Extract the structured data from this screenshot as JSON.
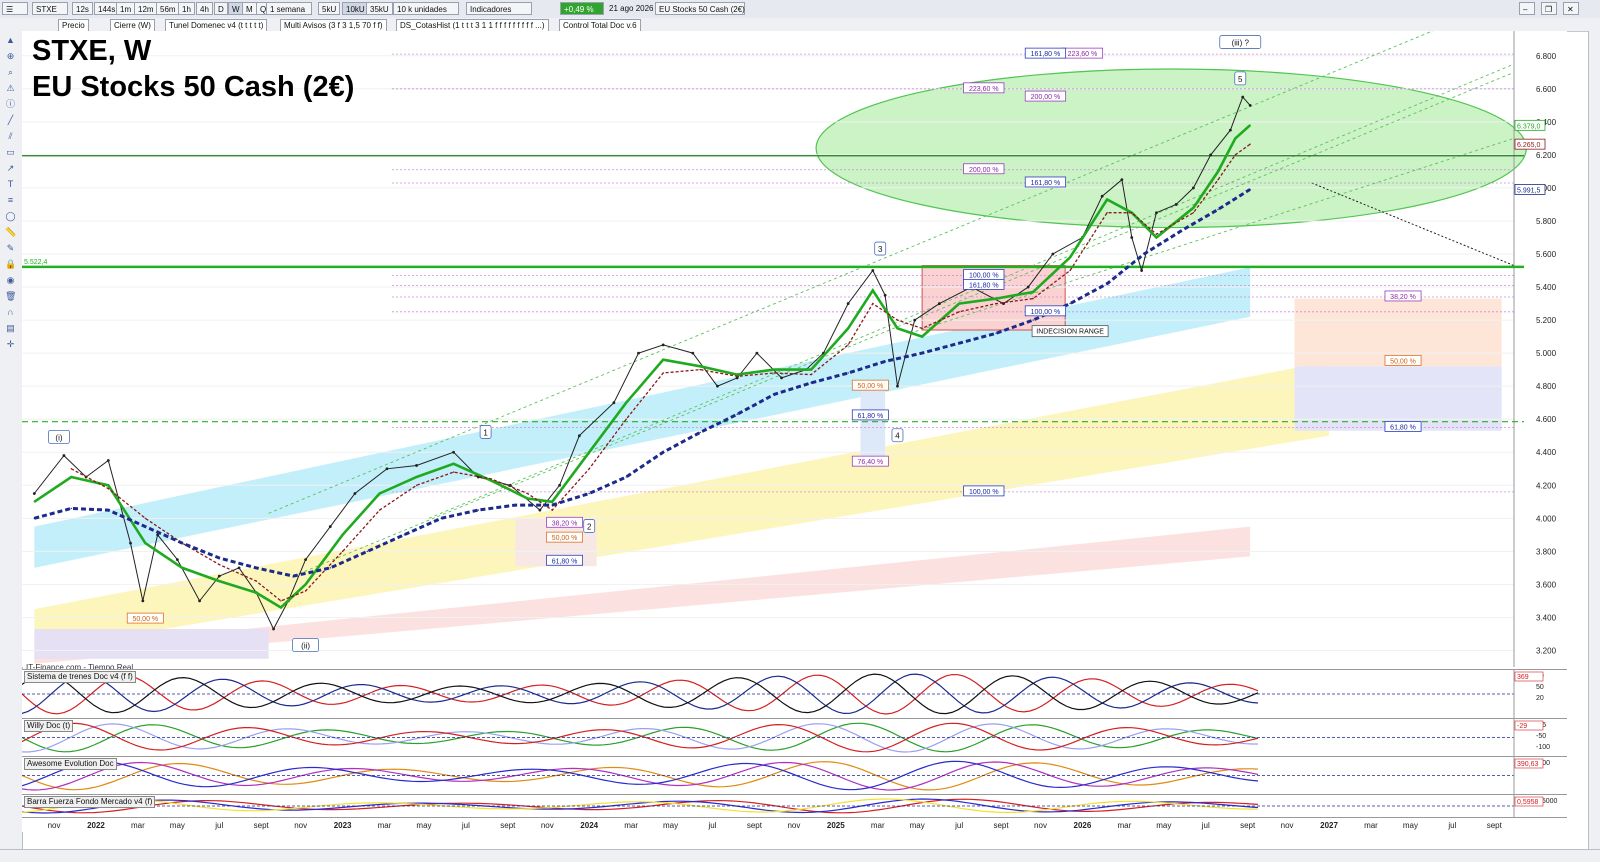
{
  "toolbar": {
    "symbol": "STXE",
    "buttons": [
      "12s",
      "144s",
      "1m",
      "12m",
      "56m",
      "1h",
      "4h",
      "D",
      "W",
      "M",
      "Q"
    ],
    "active_button": "W",
    "period": "1 semana",
    "unit_buttons": [
      "5kU",
      "10kU",
      "35kU"
    ],
    "active_unit": "10kU",
    "units_select": "10 k unidades",
    "indicators_label": "Indicadores",
    "change": "+0,49 %",
    "date": "21 ago 2026",
    "instrument": "EU Stocks 50 Cash (2€)"
  },
  "indicator_bar": [
    "Precio",
    "Cierre (W)",
    "Tunel Domenec v4 (t t t t t)",
    "Multi Avisos (3 f 3 1,5 70 f f)",
    "DS_CotasHist (1 t t t 3 1 1 f f f f f f f f f ...)",
    "Control Total Doc v.6"
  ],
  "chart_title": {
    "line1": "STXE, W",
    "line2": "EU Stocks 50 Cash (2€)"
  },
  "source_text": "IT-Finance.com - Tiempo Real",
  "chart_data": {
    "type": "line",
    "xlabel": "",
    "ylabel": "",
    "ylim": [
      3100,
      6950
    ],
    "xlim": [
      2021.7,
      2027.75
    ],
    "y_ticks": [
      3200,
      3400,
      3600,
      3800,
      4000,
      4200,
      4400,
      4600,
      4800,
      5000,
      5200,
      5400,
      5600,
      5800,
      6000,
      6200,
      6400,
      6600,
      6800
    ],
    "y_tick_labels": [
      "3.200",
      "3.400",
      "3.600",
      "3.800",
      "4.000",
      "4.200",
      "4.400",
      "4.600",
      "4.800",
      "5.000",
      "5.200",
      "5.400",
      "5.600",
      "5.800",
      "6.000",
      "6.200",
      "6.400",
      "6.600",
      "6.800"
    ],
    "x_labels": [
      {
        "x": 2021.83,
        "label": "nov"
      },
      {
        "x": 2022.0,
        "label": "2022"
      },
      {
        "x": 2022.17,
        "label": "mar"
      },
      {
        "x": 2022.33,
        "label": "may"
      },
      {
        "x": 2022.5,
        "label": "jul"
      },
      {
        "x": 2022.67,
        "label": "sept"
      },
      {
        "x": 2022.83,
        "label": "nov"
      },
      {
        "x": 2023.0,
        "label": "2023"
      },
      {
        "x": 2023.17,
        "label": "mar"
      },
      {
        "x": 2023.33,
        "label": "may"
      },
      {
        "x": 2023.5,
        "label": "jul"
      },
      {
        "x": 2023.67,
        "label": "sept"
      },
      {
        "x": 2023.83,
        "label": "nov"
      },
      {
        "x": 2024.0,
        "label": "2024"
      },
      {
        "x": 2024.17,
        "label": "mar"
      },
      {
        "x": 2024.33,
        "label": "may"
      },
      {
        "x": 2024.5,
        "label": "jul"
      },
      {
        "x": 2024.67,
        "label": "sept"
      },
      {
        "x": 2024.83,
        "label": "nov"
      },
      {
        "x": 2025.0,
        "label": "2025"
      },
      {
        "x": 2025.17,
        "label": "mar"
      },
      {
        "x": 2025.33,
        "label": "may"
      },
      {
        "x": 2025.5,
        "label": "jul"
      },
      {
        "x": 2025.67,
        "label": "sept"
      },
      {
        "x": 2025.83,
        "label": "nov"
      },
      {
        "x": 2026.0,
        "label": "2026"
      },
      {
        "x": 2026.17,
        "label": "mar"
      },
      {
        "x": 2026.33,
        "label": "may"
      },
      {
        "x": 2026.5,
        "label": "jul"
      },
      {
        "x": 2026.67,
        "label": "sept"
      },
      {
        "x": 2026.83,
        "label": "nov"
      },
      {
        "x": 2027.0,
        "label": "2027"
      },
      {
        "x": 2027.17,
        "label": "mar"
      },
      {
        "x": 2027.33,
        "label": "may"
      },
      {
        "x": 2027.5,
        "label": "jul"
      },
      {
        "x": 2027.67,
        "label": "sept"
      }
    ],
    "series": [
      {
        "color": "#222222",
        "points": [
          [
            2021.75,
            4150
          ],
          [
            2021.87,
            4380
          ],
          [
            2021.96,
            4250
          ],
          [
            2022.05,
            4350
          ],
          [
            2022.14,
            3850
          ],
          [
            2022.19,
            3500
          ],
          [
            2022.25,
            3900
          ],
          [
            2022.33,
            3750
          ],
          [
            2022.42,
            3500
          ],
          [
            2022.5,
            3650
          ],
          [
            2022.58,
            3700
          ],
          [
            2022.65,
            3550
          ],
          [
            2022.72,
            3330
          ],
          [
            2022.78,
            3500
          ],
          [
            2022.85,
            3750
          ],
          [
            2022.95,
            3950
          ],
          [
            2023.05,
            4150
          ],
          [
            2023.18,
            4300
          ],
          [
            2023.3,
            4320
          ],
          [
            2023.45,
            4400
          ],
          [
            2023.55,
            4250
          ],
          [
            2023.68,
            4200
          ],
          [
            2023.8,
            4050
          ],
          [
            2023.88,
            4200
          ],
          [
            2023.96,
            4500
          ],
          [
            2024.1,
            4700
          ],
          [
            2024.2,
            5000
          ],
          [
            2024.3,
            5050
          ],
          [
            2024.42,
            5000
          ],
          [
            2024.52,
            4800
          ],
          [
            2024.6,
            4850
          ],
          [
            2024.68,
            5000
          ],
          [
            2024.78,
            4850
          ],
          [
            2024.88,
            4900
          ],
          [
            2024.95,
            5000
          ],
          [
            2025.05,
            5300
          ],
          [
            2025.15,
            5500
          ],
          [
            2025.2,
            5350
          ],
          [
            2025.25,
            4800
          ],
          [
            2025.32,
            5200
          ],
          [
            2025.42,
            5300
          ],
          [
            2025.55,
            5400
          ],
          [
            2025.68,
            5300
          ],
          [
            2025.78,
            5400
          ],
          [
            2025.88,
            5600
          ],
          [
            2026.0,
            5700
          ],
          [
            2026.08,
            5950
          ],
          [
            2026.16,
            6050
          ],
          [
            2026.2,
            5700
          ],
          [
            2026.24,
            5500
          ],
          [
            2026.3,
            5850
          ],
          [
            2026.38,
            5900
          ],
          [
            2026.45,
            6000
          ],
          [
            2026.52,
            6200
          ],
          [
            2026.6,
            6350
          ],
          [
            2026.65,
            6550
          ],
          [
            2026.68,
            6500
          ]
        ]
      },
      {
        "color": "#1faa1f",
        "points": [
          [
            2021.75,
            4100
          ],
          [
            2021.9,
            4250
          ],
          [
            2022.05,
            4200
          ],
          [
            2022.2,
            3850
          ],
          [
            2022.35,
            3700
          ],
          [
            2022.5,
            3620
          ],
          [
            2022.65,
            3550
          ],
          [
            2022.75,
            3460
          ],
          [
            2022.85,
            3600
          ],
          [
            2023.0,
            3900
          ],
          [
            2023.15,
            4150
          ],
          [
            2023.3,
            4250
          ],
          [
            2023.45,
            4330
          ],
          [
            2023.6,
            4230
          ],
          [
            2023.75,
            4120
          ],
          [
            2023.85,
            4100
          ],
          [
            2024.0,
            4400
          ],
          [
            2024.15,
            4700
          ],
          [
            2024.3,
            4960
          ],
          [
            2024.45,
            4920
          ],
          [
            2024.6,
            4870
          ],
          [
            2024.75,
            4900
          ],
          [
            2024.9,
            4900
          ],
          [
            2025.05,
            5150
          ],
          [
            2025.15,
            5380
          ],
          [
            2025.25,
            5150
          ],
          [
            2025.35,
            5100
          ],
          [
            2025.5,
            5300
          ],
          [
            2025.65,
            5330
          ],
          [
            2025.8,
            5370
          ],
          [
            2025.95,
            5580
          ],
          [
            2026.1,
            5930
          ],
          [
            2026.2,
            5850
          ],
          [
            2026.3,
            5700
          ],
          [
            2026.45,
            5880
          ],
          [
            2026.55,
            6100
          ],
          [
            2026.62,
            6300
          ],
          [
            2026.68,
            6380
          ]
        ]
      },
      {
        "color": "#8b1a1a",
        "points": [
          [
            2021.9,
            4300
          ],
          [
            2022.05,
            4180
          ],
          [
            2022.2,
            4000
          ],
          [
            2022.35,
            3850
          ],
          [
            2022.5,
            3720
          ],
          [
            2022.65,
            3620
          ],
          [
            2022.75,
            3500
          ],
          [
            2022.85,
            3560
          ],
          [
            2023.0,
            3800
          ],
          [
            2023.15,
            4050
          ],
          [
            2023.3,
            4200
          ],
          [
            2023.45,
            4280
          ],
          [
            2023.6,
            4240
          ],
          [
            2023.75,
            4150
          ],
          [
            2023.85,
            4050
          ],
          [
            2024.0,
            4300
          ],
          [
            2024.15,
            4600
          ],
          [
            2024.3,
            4880
          ],
          [
            2024.45,
            4900
          ],
          [
            2024.6,
            4860
          ],
          [
            2024.75,
            4880
          ],
          [
            2024.9,
            4870
          ],
          [
            2025.05,
            5050
          ],
          [
            2025.15,
            5300
          ],
          [
            2025.25,
            5200
          ],
          [
            2025.35,
            5150
          ],
          [
            2025.5,
            5250
          ],
          [
            2025.65,
            5300
          ],
          [
            2025.8,
            5330
          ],
          [
            2025.95,
            5500
          ],
          [
            2026.1,
            5850
          ],
          [
            2026.2,
            5850
          ],
          [
            2026.3,
            5720
          ],
          [
            2026.45,
            5850
          ],
          [
            2026.55,
            6050
          ],
          [
            2026.62,
            6200
          ],
          [
            2026.68,
            6265
          ]
        ]
      },
      {
        "color": "#1c2a8c",
        "points": [
          [
            2021.75,
            4000
          ],
          [
            2021.9,
            4060
          ],
          [
            2022.05,
            4050
          ],
          [
            2022.2,
            3950
          ],
          [
            2022.35,
            3850
          ],
          [
            2022.5,
            3760
          ],
          [
            2022.65,
            3700
          ],
          [
            2022.8,
            3650
          ],
          [
            2022.95,
            3700
          ],
          [
            2023.1,
            3800
          ],
          [
            2023.25,
            3900
          ],
          [
            2023.4,
            4000
          ],
          [
            2023.55,
            4050
          ],
          [
            2023.7,
            4080
          ],
          [
            2023.85,
            4080
          ],
          [
            2024.0,
            4150
          ],
          [
            2024.15,
            4250
          ],
          [
            2024.3,
            4400
          ],
          [
            2024.45,
            4520
          ],
          [
            2024.6,
            4630
          ],
          [
            2024.75,
            4750
          ],
          [
            2024.9,
            4820
          ],
          [
            2025.05,
            4880
          ],
          [
            2025.2,
            4950
          ],
          [
            2025.35,
            5000
          ],
          [
            2025.5,
            5060
          ],
          [
            2025.65,
            5120
          ],
          [
            2025.8,
            5200
          ],
          [
            2025.95,
            5300
          ],
          [
            2026.1,
            5420
          ],
          [
            2026.25,
            5600
          ],
          [
            2026.4,
            5740
          ],
          [
            2026.55,
            5870
          ],
          [
            2026.68,
            5991
          ]
        ]
      }
    ],
    "horizontal_levels": [
      {
        "y": 5522.4,
        "color": "#22b022",
        "label": "5.522,4"
      },
      {
        "y": 4585,
        "color": "#22b022",
        "label": ""
      },
      {
        "y": 6195,
        "color": "#1e7a1e",
        "label": ""
      }
    ],
    "fib_labels": [
      {
        "x": 2026.0,
        "y": 6810,
        "text": "223,60 %"
      },
      {
        "x": 2025.85,
        "y": 6810,
        "text": "161,80 %"
      },
      {
        "x": 2025.6,
        "y": 6600,
        "text": "223,60 %"
      },
      {
        "x": 2025.85,
        "y": 6550,
        "text": "200,00 %"
      },
      {
        "x": 2025.6,
        "y": 6110,
        "text": "200,00 %"
      },
      {
        "x": 2025.85,
        "y": 6030,
        "text": "161,80 %"
      },
      {
        "x": 2025.6,
        "y": 5470,
        "text": "100,00 %"
      },
      {
        "x": 2025.6,
        "y": 5410,
        "text": "161,80 %"
      },
      {
        "x": 2025.85,
        "y": 5250,
        "text": "100,00 %"
      },
      {
        "x": 2025.6,
        "y": 4160,
        "text": "100,00 %"
      },
      {
        "x": 2025.14,
        "y": 4800,
        "text": "50,00 %"
      },
      {
        "x": 2025.14,
        "y": 4620,
        "text": "61,80 %"
      },
      {
        "x": 2025.14,
        "y": 4340,
        "text": "76,40 %"
      },
      {
        "x": 2023.9,
        "y": 3970,
        "text": "38,20 %"
      },
      {
        "x": 2023.9,
        "y": 3880,
        "text": "50,00 %"
      },
      {
        "x": 2023.9,
        "y": 3740,
        "text": "61,80 %"
      },
      {
        "x": 2022.2,
        "y": 3390,
        "text": "50,00 %"
      },
      {
        "x": 2027.3,
        "y": 5340,
        "text": "38,20 %"
      },
      {
        "x": 2027.3,
        "y": 4950,
        "text": "50,00 %"
      },
      {
        "x": 2027.3,
        "y": 4550,
        "text": "61,80 %"
      }
    ],
    "wave_labels": [
      {
        "x": 2021.85,
        "y": 4490,
        "text": "(i)"
      },
      {
        "x": 2022.85,
        "y": 3230,
        "text": "(ii)"
      },
      {
        "x": 2023.58,
        "y": 4520,
        "text": "1"
      },
      {
        "x": 2024.0,
        "y": 3950,
        "text": "2"
      },
      {
        "x": 2025.18,
        "y": 5630,
        "text": "3"
      },
      {
        "x": 2025.25,
        "y": 4500,
        "text": "4"
      },
      {
        "x": 2026.64,
        "y": 6660,
        "text": "5"
      },
      {
        "x": 2026.64,
        "y": 6880,
        "text": "(iii) ?"
      }
    ],
    "annotations": [
      {
        "x": 2025.95,
        "y": 5130,
        "text": "INDECISION RANGE"
      }
    ],
    "price_tags": [
      {
        "y": 6379,
        "text": "6.379,0",
        "color": "#1faa1f"
      },
      {
        "y": 6265,
        "text": "6.265,0",
        "color": "#8b1a1a"
      },
      {
        "y": 5991,
        "text": "5.991,5",
        "color": "#1c2a8c"
      }
    ]
  },
  "subpanels": [
    {
      "label": "Sistema de trenes Doc v4 (f f)",
      "ticks": [
        "80",
        "50",
        "20"
      ],
      "tag": "369"
    },
    {
      "label": "Willy Doc (t)",
      "ticks": [
        "-25",
        "-50",
        "-100"
      ],
      "tag": "-29"
    },
    {
      "label": "Awesome Evolution Doc",
      "ticks": [
        "-500"
      ],
      "tag": "390,63"
    },
    {
      "label": "Barra Fuerza Fondo Mercado v4 (f)",
      "ticks": [
        "0,5000"
      ],
      "tag": "0,5958"
    }
  ]
}
